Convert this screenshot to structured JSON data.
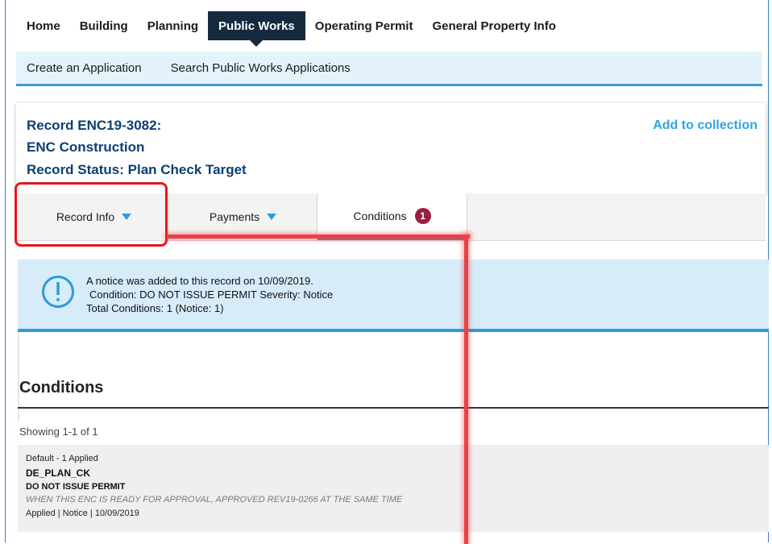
{
  "topnav": {
    "items": [
      {
        "label": "Home"
      },
      {
        "label": "Building"
      },
      {
        "label": "Planning"
      },
      {
        "label": "Public Works",
        "active": true
      },
      {
        "label": "Operating Permit"
      },
      {
        "label": "General Property Info"
      }
    ]
  },
  "subnav": {
    "items": [
      {
        "label": "Create an Application"
      },
      {
        "label": "Search Public Works Applications"
      }
    ]
  },
  "record": {
    "id_line": "Record ENC19-3082:",
    "type_line": "ENC Construction",
    "status_line": "Record Status: Plan Check Target",
    "add_to_collection": "Add to collection"
  },
  "tabs": [
    {
      "label": "Record Info",
      "icon": "triangle-down-icon"
    },
    {
      "label": "Payments",
      "icon": "triangle-down-icon"
    },
    {
      "label": "Conditions",
      "badge": "1"
    }
  ],
  "notice": {
    "icon": "exclamation-circle-icon",
    "line1": "A notice was added to this record on 10/09/2019.",
    "line2": "Condition:  DO NOT ISSUE PERMIT   Severity:  Notice",
    "line3": "Total Conditions: 1  (Notice: 1)"
  },
  "conditions": {
    "title": "Conditions",
    "showing": "Showing 1-1 of 1",
    "items": [
      {
        "group": "Default - 1 Applied",
        "code": "DE_PLAN_CK",
        "name": "DO NOT ISSUE PERMIT",
        "description": "WHEN THIS ENC IS READY FOR APPROVAL, APPROVED REV19-0266 AT THE SAME TIME",
        "meta": "Applied | Notice | 10/09/2019"
      }
    ]
  },
  "colors": {
    "nav_active": "#152a3f",
    "subnav_bg": "#e4f3fb",
    "accent_blue": "#2ea3e6",
    "record_title": "#0c3f73",
    "badge": "#9a1f40",
    "highlight_red": "#e8161c"
  }
}
